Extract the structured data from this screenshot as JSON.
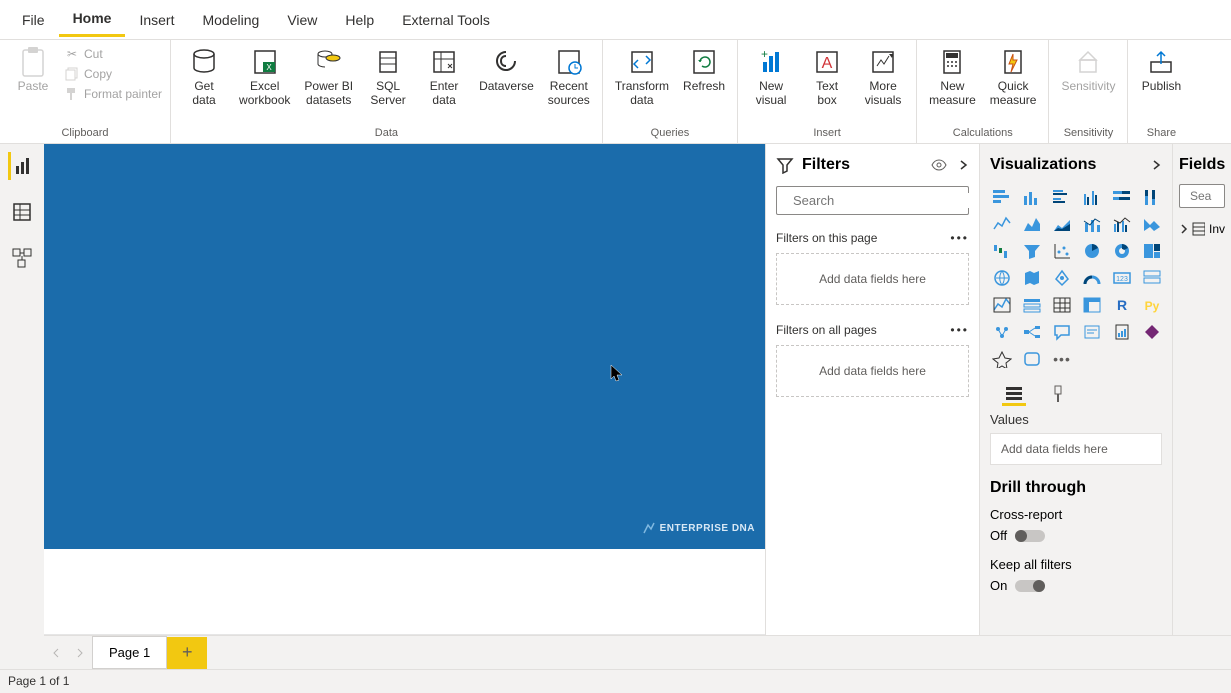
{
  "menubar": {
    "file": "File",
    "home": "Home",
    "insert": "Insert",
    "modeling": "Modeling",
    "view": "View",
    "help": "Help",
    "external_tools": "External Tools"
  },
  "ribbon": {
    "clipboard": {
      "paste": "Paste",
      "cut": "Cut",
      "copy": "Copy",
      "format_painter": "Format painter",
      "group_label": "Clipboard"
    },
    "data": {
      "get_data": "Get\ndata",
      "excel": "Excel\nworkbook",
      "pbi_datasets": "Power BI\ndatasets",
      "sql_server": "SQL\nServer",
      "enter_data": "Enter\ndata",
      "dataverse": "Dataverse",
      "recent_sources": "Recent\nsources",
      "group_label": "Data"
    },
    "queries": {
      "transform": "Transform\ndata",
      "refresh": "Refresh",
      "group_label": "Queries"
    },
    "insert": {
      "new_visual": "New\nvisual",
      "text_box": "Text\nbox",
      "more_visuals": "More\nvisuals",
      "group_label": "Insert"
    },
    "calculations": {
      "new_measure": "New\nmeasure",
      "quick_measure": "Quick\nmeasure",
      "group_label": "Calculations"
    },
    "sensitivity": {
      "sensitivity": "Sensitivity",
      "group_label": "Sensitivity"
    },
    "share": {
      "publish": "Publish",
      "group_label": "Share"
    }
  },
  "canvas": {
    "logo_text": "ENTERPRISE DNA"
  },
  "filters": {
    "title": "Filters",
    "search_placeholder": "Search",
    "on_this_page": "Filters on this page",
    "on_all_pages": "Filters on all pages",
    "add_fields": "Add data fields here"
  },
  "viz": {
    "title": "Visualizations",
    "values_label": "Values",
    "values_placeholder": "Add data fields here",
    "drill_title": "Drill through",
    "cross_report": "Cross-report",
    "cross_report_state": "Off",
    "keep_filters": "Keep all filters",
    "keep_filters_state": "On"
  },
  "fields": {
    "title": "Fields",
    "search_placeholder": "Sea",
    "table1": "Inv"
  },
  "pages": {
    "page1": "Page 1"
  },
  "status": {
    "page_info": "Page 1 of 1"
  }
}
